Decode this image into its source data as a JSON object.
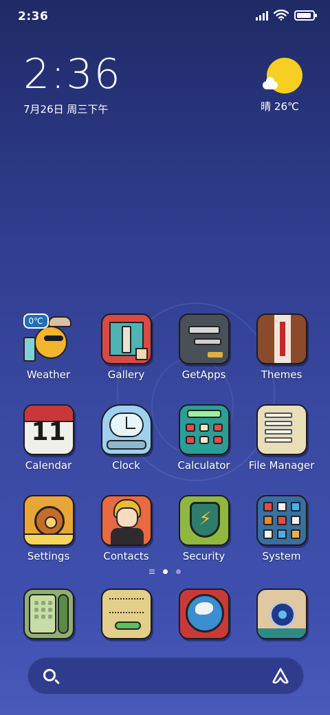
{
  "status_bar": {
    "time": "2:36",
    "icons": [
      "signal-icon",
      "wifi-icon",
      "battery-icon"
    ],
    "battery_level": 0.9
  },
  "clock_widget": {
    "time": "2:36",
    "date": "7月26日 周三下午"
  },
  "weather_widget": {
    "condition_icon": "sunny-icon",
    "text": "晴 26℃"
  },
  "apps": [
    {
      "label": "Weather",
      "icon": "weather-icon",
      "badge": "0℃"
    },
    {
      "label": "Gallery",
      "icon": "gallery-icon"
    },
    {
      "label": "GetApps",
      "icon": "getapps-icon"
    },
    {
      "label": "Themes",
      "icon": "themes-icon"
    },
    {
      "label": "Calendar",
      "icon": "calendar-icon",
      "day": "11"
    },
    {
      "label": "Clock",
      "icon": "clock-icon"
    },
    {
      "label": "Calculator",
      "icon": "calculator-icon"
    },
    {
      "label": "File Manager",
      "icon": "file-manager-icon"
    },
    {
      "label": "Settings",
      "icon": "settings-icon"
    },
    {
      "label": "Contacts",
      "icon": "contacts-icon"
    },
    {
      "label": "Security",
      "icon": "security-icon"
    },
    {
      "label": "System",
      "icon": "system-icon"
    }
  ],
  "page_indicator": {
    "pages": 2,
    "active": 0
  },
  "dock": [
    {
      "icon": "phone-icon"
    },
    {
      "icon": "messages-icon"
    },
    {
      "icon": "browser-icon"
    },
    {
      "icon": "camera-icon"
    }
  ],
  "search_bar": {
    "left_icon": "search-icon",
    "right_icon": "assistant-icon"
  },
  "colors": {
    "background_top": "#1f2a66",
    "background_bottom": "#4a5abb",
    "sun": "#f6cf22"
  }
}
